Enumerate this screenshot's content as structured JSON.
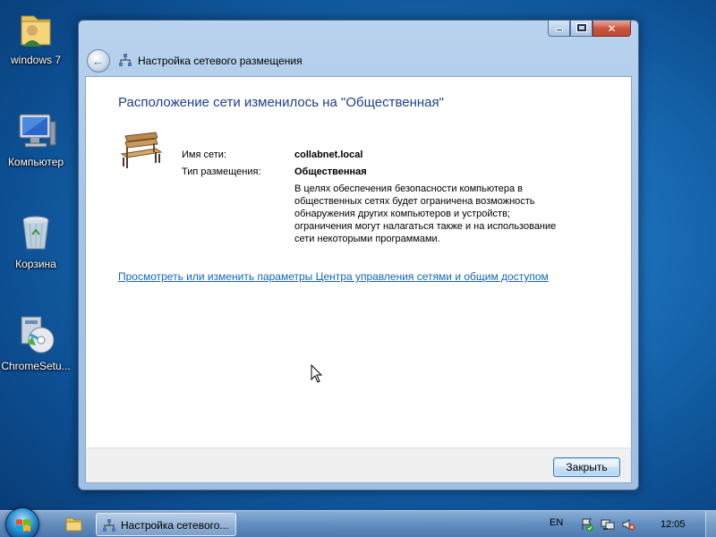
{
  "desktop": {
    "icons": [
      {
        "label": "windows 7",
        "icon": "user-folder-icon"
      },
      {
        "label": "Компьютер",
        "icon": "computer-icon"
      },
      {
        "label": "Корзина",
        "icon": "recycle-bin-icon"
      },
      {
        "label": "ChromeSetu...",
        "icon": "installer-icon"
      }
    ]
  },
  "window": {
    "nav_title": "Настройка сетевого размещения",
    "heading": "Расположение сети изменилось на \"Общественная\"",
    "network_name_label": "Имя сети:",
    "network_name_value": "collabnet.local",
    "location_type_label": "Тип размещения:",
    "location_type_value": "Общественная",
    "description": "В целях обеспечения безопасности компьютера в общественных сетях будет ограничена возможность обнаружения других компьютеров и устройств; ограничения могут налагаться также и на использование сети некоторыми программами.",
    "settings_link": "Просмотреть или изменить параметры Центра управления сетями и общим доступом",
    "close_button": "Закрыть"
  },
  "taskbar": {
    "task_label": "Настройка сетевого...",
    "language": "EN",
    "time": "12:05"
  }
}
